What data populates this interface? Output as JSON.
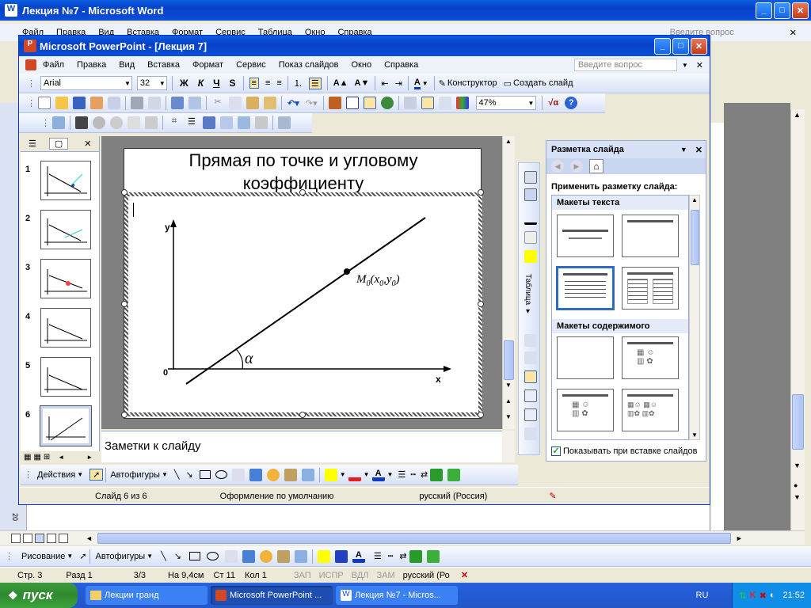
{
  "word": {
    "title": "Лекция №7 - Microsoft Word",
    "menu": [
      "Файл",
      "Правка",
      "Вид",
      "Вставка",
      "Формат",
      "Сервис",
      "Таблица",
      "Окно",
      "Справка"
    ],
    "help_placeholder": "Введите вопрос",
    "status": {
      "page": "Стр. 3",
      "section": "Разд 1",
      "pages": "3/3",
      "at": "На 9,4см",
      "line": "Ст 11",
      "col": "Кол 1",
      "rec": "ЗАП",
      "trk": "ИСПР",
      "ext": "ВДЛ",
      "ovr": "ЗАМ",
      "lang": "русский (Ро"
    },
    "drawing_label": "Рисование",
    "autoshapes_label": "Автофигуры",
    "ruler_mark": "20"
  },
  "ppt": {
    "title": "Microsoft PowerPoint - [Лекция 7]",
    "menu": [
      "Файл",
      "Правка",
      "Вид",
      "Вставка",
      "Формат",
      "Сервис",
      "Показ слайдов",
      "Окно",
      "Справка"
    ],
    "help_placeholder": "Введите вопрос",
    "font": "Arial",
    "size": "32",
    "bold": "Ж",
    "italic": "К",
    "underline": "Ч",
    "shadow": "S",
    "designer": "Конструктор",
    "new_slide": "Создать слайд",
    "zoom": "47%",
    "slide_title_line1": "Прямая по точке и угловому",
    "slide_title_line2": "коэффициенту",
    "notes_placeholder": "Заметки к слайду",
    "slide_numbers": [
      "1",
      "2",
      "3",
      "4",
      "5",
      "6"
    ],
    "actions_label": "Действия",
    "autoshapes_label": "Автофигуры",
    "status": {
      "slide": "Слайд 6 из 6",
      "design": "Оформление по умолчанию",
      "lang": "русский (Россия)"
    },
    "table_label": "Таблица"
  },
  "graph": {
    "y": "y",
    "x": "x",
    "o": "0",
    "point": "M",
    "sub0": "0",
    "px": "x",
    "py": "y",
    "alpha": "α"
  },
  "taskpane": {
    "title": "Разметка слайда",
    "apply": "Применить разметку слайда:",
    "text_layouts": "Макеты текста",
    "content_layouts": "Макеты содержимого",
    "show_checkbox": "Показывать при вставке слайдов"
  },
  "taskbar": {
    "start": "пуск",
    "tasks": [
      "Лекции гранд",
      "Microsoft PowerPoint ...",
      "Лекция №7 - Micros..."
    ],
    "lang": "RU",
    "time": "21:52"
  }
}
